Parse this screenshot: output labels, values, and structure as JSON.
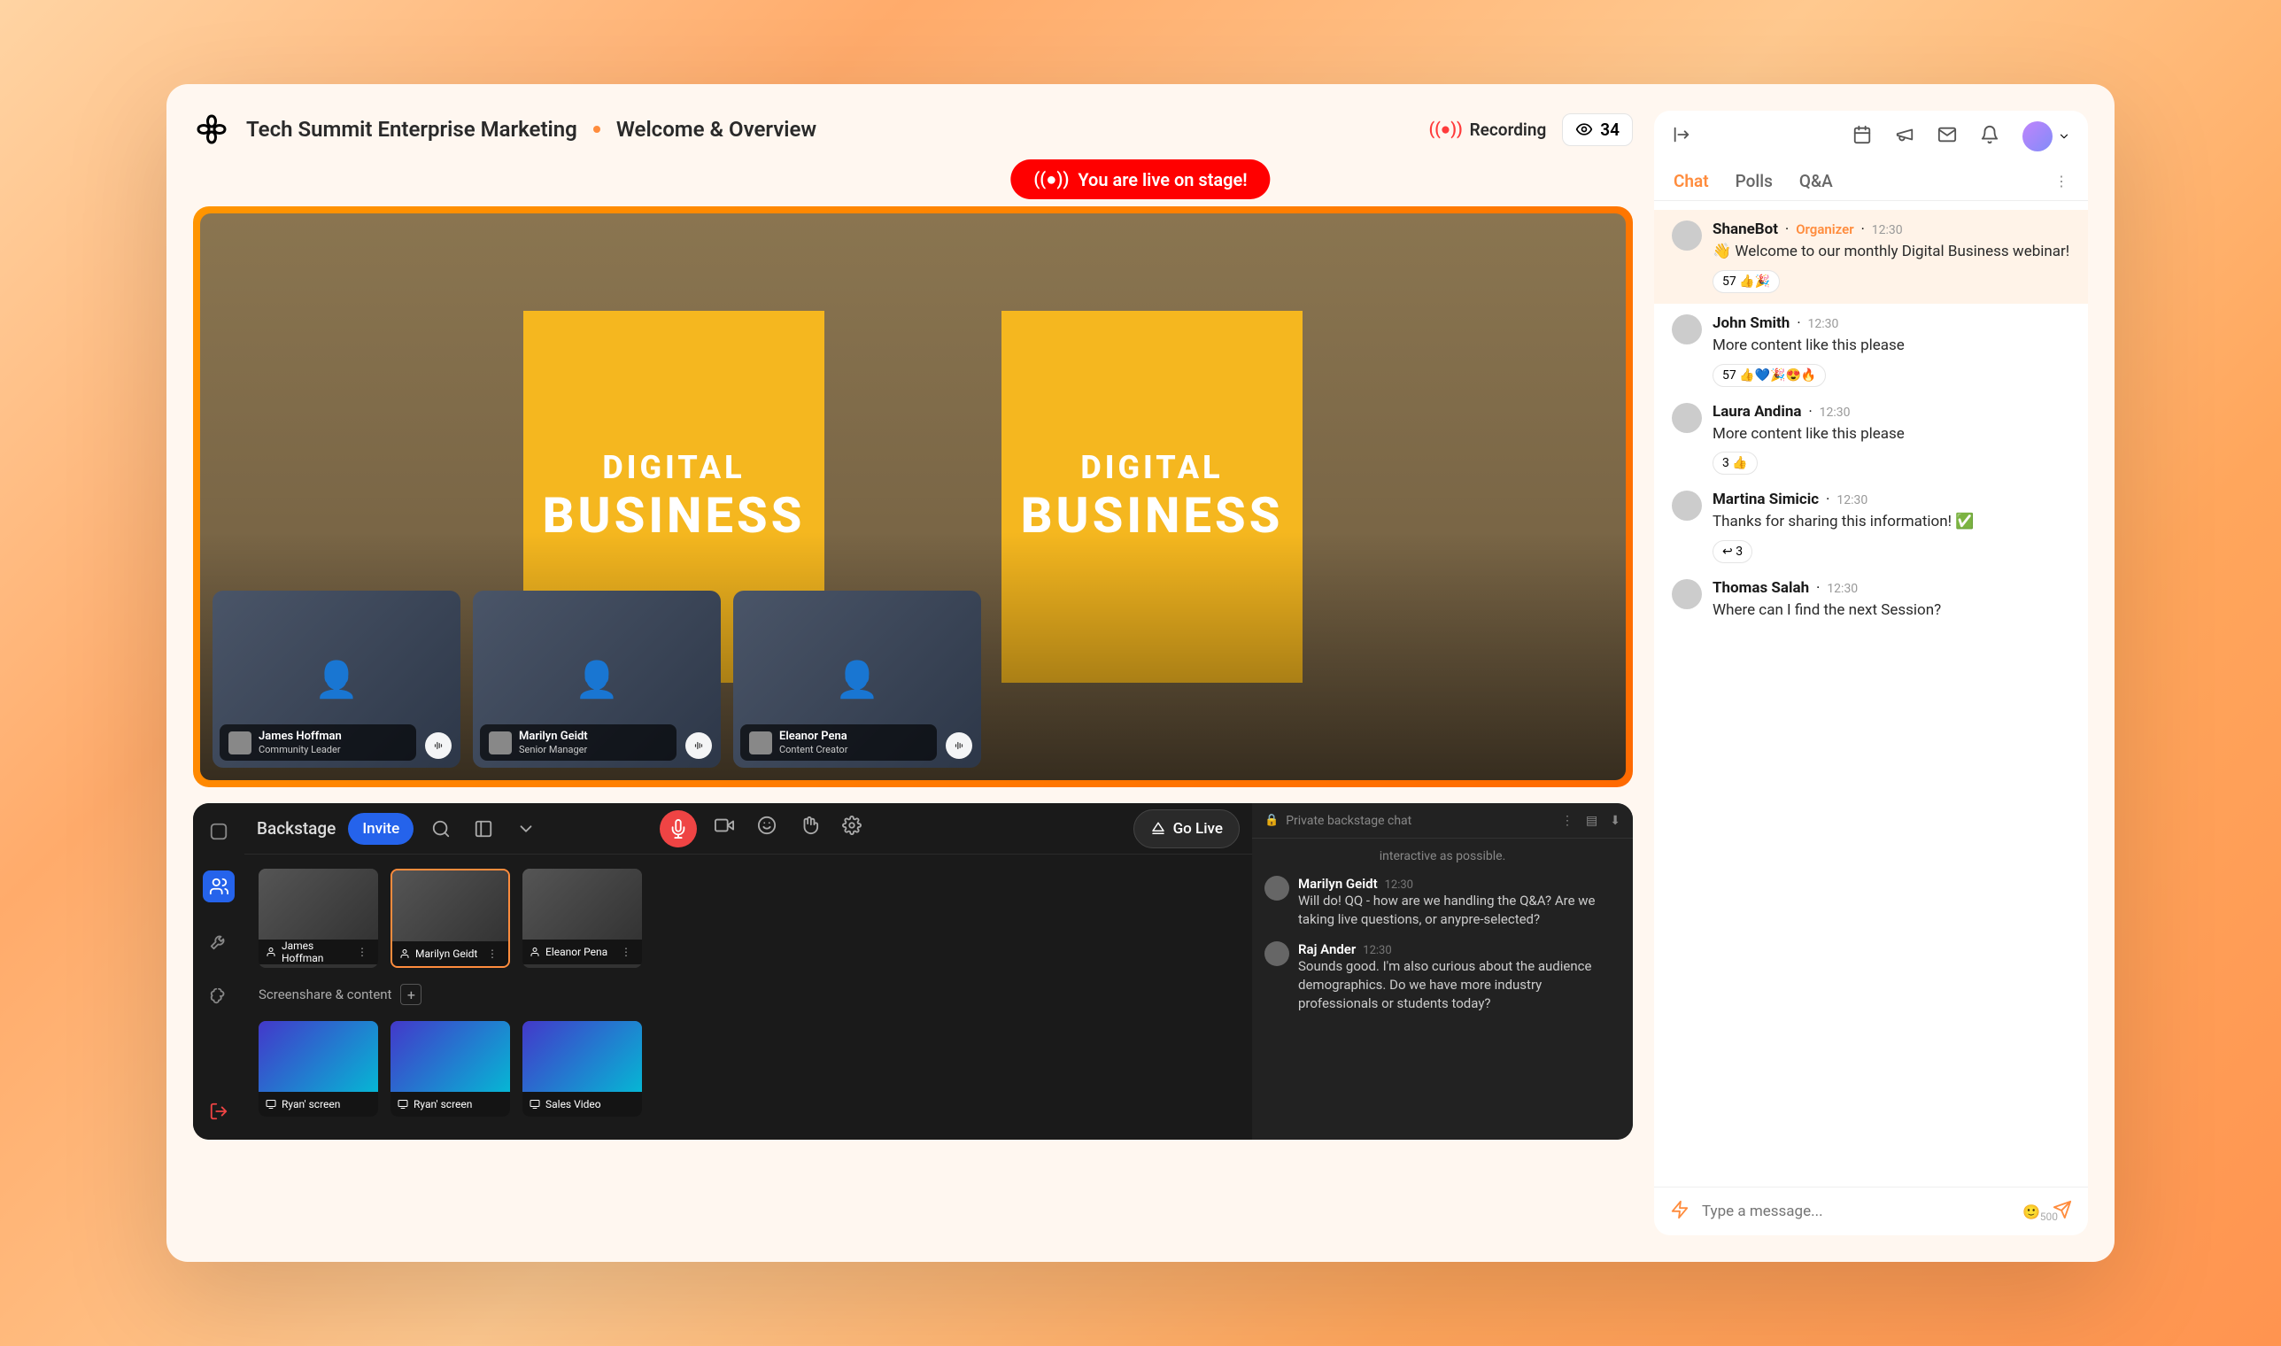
{
  "header": {
    "title": "Tech Summit Enterprise Marketing",
    "subtitle": "Welcome & Overview",
    "recording_label": "Recording",
    "viewer_count": "34",
    "live_banner": "You are live on stage!"
  },
  "stage": {
    "banner_line1": "DIGITAL",
    "banner_line2": "BUSINESS",
    "speakers": [
      {
        "name": "James Hoffman",
        "role": "Community Leader"
      },
      {
        "name": "Marilyn Geidt",
        "role": "Senior Manager"
      },
      {
        "name": "Eleanor Pena",
        "role": "Content Creator"
      }
    ]
  },
  "backstage": {
    "label": "Backstage",
    "invite_label": "Invite",
    "golive_label": "Go Live",
    "participants": [
      {
        "name": "James Hoffman"
      },
      {
        "name": "Marilyn Geidt"
      },
      {
        "name": "Eleanor Pena"
      }
    ],
    "screenshare_label": "Screenshare & content",
    "content": [
      {
        "name": "Ryan' screen"
      },
      {
        "name": "Ryan' screen"
      },
      {
        "name": "Sales Video"
      }
    ],
    "private_chat_label": "Private backstage chat",
    "chat_snippet": "interactive as possible.",
    "messages": [
      {
        "author": "Marilyn  Geidt",
        "time": "12:30",
        "text": "Will do! QQ - how are we handling the Q&A? Are we taking live questions, or anypre-selected?"
      },
      {
        "author": "Raj Ander",
        "time": "12:30",
        "text": "Sounds good. I'm also curious about the audience demographics. Do we have more industry professionals or students today?"
      }
    ]
  },
  "sidebar": {
    "tabs": {
      "chat": "Chat",
      "polls": "Polls",
      "qna": "Q&A"
    },
    "messages": [
      {
        "author": "ShaneBot",
        "role": "Organizer",
        "time": "12:30",
        "text": "👋 Welcome to our monthly Digital Business webinar!",
        "reactions": "57 👍🎉",
        "highlight": true
      },
      {
        "author": "John Smith",
        "role": "",
        "time": "12:30",
        "text": "More content like this please",
        "reactions": "57 👍💙🎉😍🔥"
      },
      {
        "author": "Laura Andina",
        "role": "",
        "time": "12:30",
        "text": "More content like this please",
        "reactions": "3 👍"
      },
      {
        "author": "Martina Simicic",
        "role": "",
        "time": "12:30",
        "text": "Thanks for sharing this information! ✅",
        "reactions": "↩ 3"
      },
      {
        "author": "Thomas Salah",
        "role": "",
        "time": "12:30",
        "text": "Where can I find the next Session?",
        "reactions": ""
      }
    ],
    "compose_placeholder": "Type a message...",
    "char_count": "500"
  }
}
